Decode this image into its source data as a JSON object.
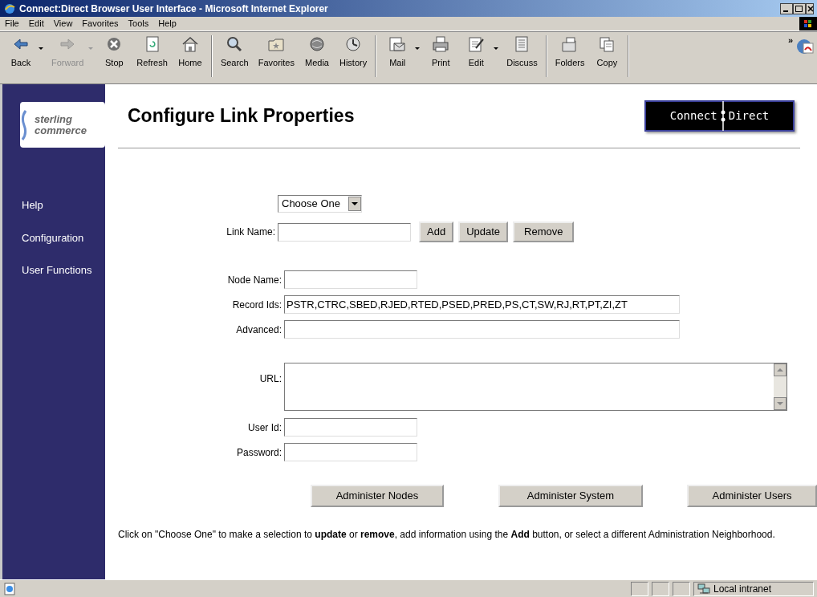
{
  "window": {
    "title": "Connect:Direct Browser User Interface - Microsoft Internet Explorer"
  },
  "menu": [
    "File",
    "Edit",
    "View",
    "Favorites",
    "Tools",
    "Help"
  ],
  "toolbar_groups": [
    [
      {
        "label": "Back",
        "kind": "back",
        "disabled": false,
        "dropdown": true
      },
      {
        "label": "Forward",
        "kind": "forward",
        "disabled": true,
        "dropdown": true
      },
      {
        "label": "Stop",
        "kind": "stop",
        "disabled": false,
        "dropdown": false
      },
      {
        "label": "Refresh",
        "kind": "refresh",
        "disabled": false,
        "dropdown": false
      },
      {
        "label": "Home",
        "kind": "home",
        "disabled": false,
        "dropdown": false
      }
    ],
    [
      {
        "label": "Search",
        "kind": "search",
        "disabled": false,
        "dropdown": false
      },
      {
        "label": "Favorites",
        "kind": "favorites",
        "disabled": false,
        "dropdown": false
      },
      {
        "label": "Media",
        "kind": "media",
        "disabled": false,
        "dropdown": false
      },
      {
        "label": "History",
        "kind": "history",
        "disabled": false,
        "dropdown": false
      }
    ],
    [
      {
        "label": "Mail",
        "kind": "mail",
        "disabled": false,
        "dropdown": true
      },
      {
        "label": "Print",
        "kind": "print",
        "disabled": false,
        "dropdown": false
      },
      {
        "label": "Edit",
        "kind": "edit",
        "disabled": false,
        "dropdown": true
      },
      {
        "label": "Discuss",
        "kind": "discuss",
        "disabled": false,
        "dropdown": false
      }
    ],
    [
      {
        "label": "Folders",
        "kind": "folders",
        "disabled": false,
        "dropdown": false
      },
      {
        "label": "Copy",
        "kind": "copy",
        "disabled": false,
        "dropdown": false
      }
    ]
  ],
  "toolbar_more": "»",
  "sidebar": {
    "logo": {
      "line1": "sterling",
      "line2": "commerce"
    },
    "items": [
      "Help",
      "Configuration",
      "User Functions"
    ]
  },
  "page": {
    "title": "Configure Link Properties",
    "brand": {
      "left": "Connect",
      "right": "Direct"
    }
  },
  "selector": {
    "value": "Choose One"
  },
  "link_row": {
    "label": "Link Name:",
    "buttons": [
      "Add",
      "Update",
      "Remove"
    ]
  },
  "fields": [
    {
      "label": "Node Name:",
      "kind": "short_text"
    },
    {
      "label": "Record Ids:",
      "kind": "long_text",
      "value": "PSTR,CTRC,SBED,RJED,RTED,PSED,PRED,PS,CT,SW,RJ,RT,PT,ZI,ZT"
    },
    {
      "label": "Advanced:",
      "kind": "long_text"
    },
    {
      "label": "URL:",
      "kind": "textarea"
    },
    {
      "label": "User Id:",
      "kind": "short_text"
    },
    {
      "label": "Password:",
      "kind": "password"
    }
  ],
  "admin_buttons": [
    "Administer Nodes",
    "Administer System",
    "Administer Users"
  ],
  "note": "Click on \"Choose One\" to make a selection to **update** or **remove**, add information using the **Add** button, or select a different Administration Neighborhood.",
  "status_bar": {
    "zone": "Local intranet"
  }
}
